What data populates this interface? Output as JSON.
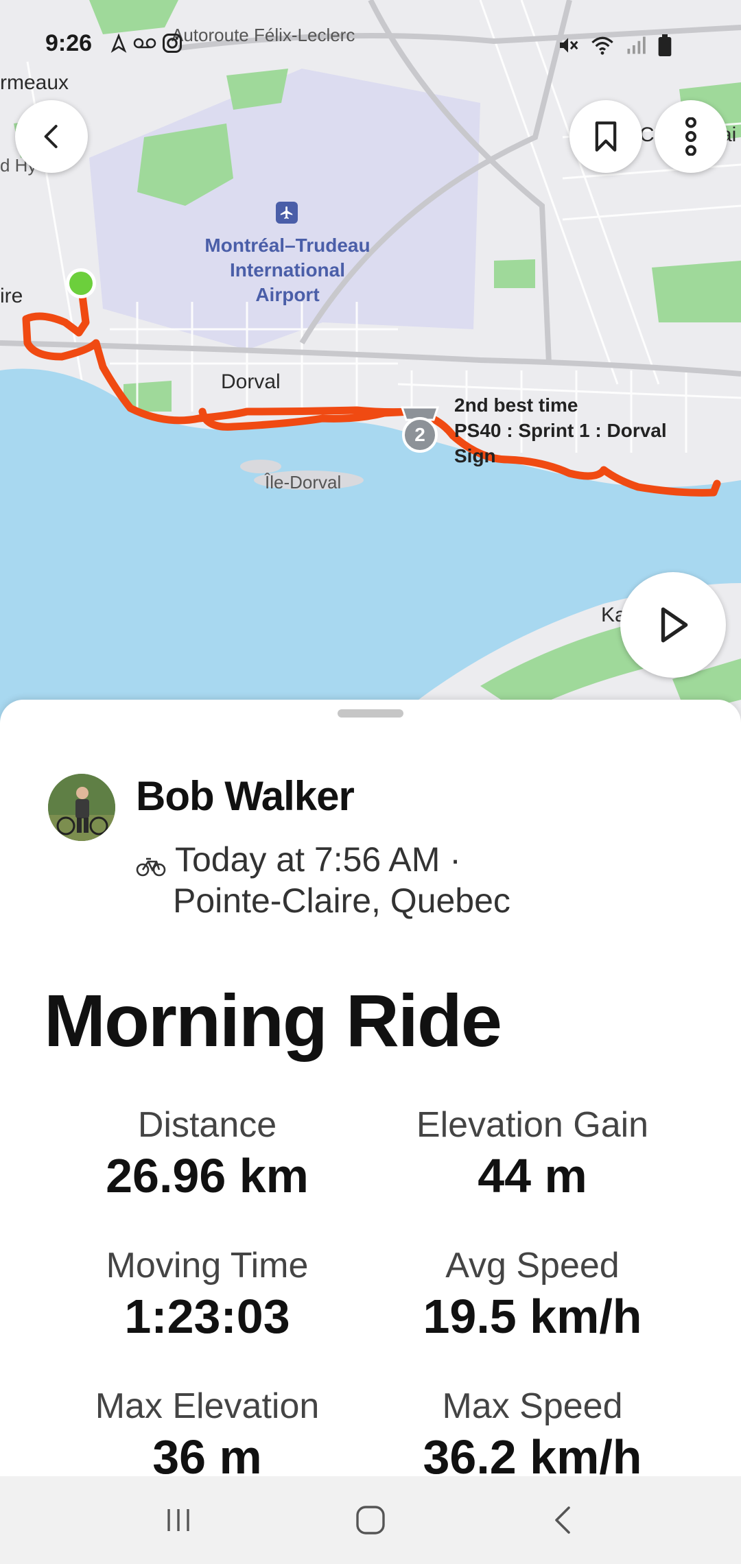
{
  "status_bar": {
    "time": "9:26",
    "icons_left": [
      "navigation-icon",
      "voicemail-icon",
      "instagram-icon"
    ],
    "icons_right": [
      "mute-icon",
      "wifi-icon",
      "signal-icon",
      "battery-icon"
    ]
  },
  "map": {
    "labels": {
      "highway": "Autoroute Félix-Leclerc",
      "ormeaux": "rmeaux",
      "hwy_left": "d Hy",
      "claire": "ire",
      "airport_line1": "Montréal–Trudeau",
      "airport_line2": "International",
      "airport_line3": "Airport",
      "dorval": "Dorval",
      "ile_dorval": "Île-Dorval",
      "c_label": "C",
      "ai_label": "ai",
      "ka_label": "Ka"
    },
    "achievement": {
      "rank": "2",
      "line1": "2nd best time",
      "line2": "PS40 : Sprint 1 : Dorval",
      "line3": "Sign"
    },
    "colors": {
      "water": "#a8d8f0",
      "land": "#ececef",
      "park": "#9fd99a",
      "airport": "#dcdcf0",
      "route": "#f04a12",
      "start_dot": "#6ccf3c"
    }
  },
  "buttons": {
    "back": "back-icon",
    "save": "bookmark-icon",
    "more": "more-vertical-icon",
    "play": "play-icon"
  },
  "activity": {
    "athlete": "Bob Walker",
    "sport_icon": "bike-icon",
    "datetime": "Today at 7:56 AM ·",
    "location": "Pointe-Claire, Quebec",
    "title": "Morning Ride",
    "stats": [
      {
        "label": "Distance",
        "value": "26.96 km"
      },
      {
        "label": "Elevation Gain",
        "value": "44 m"
      },
      {
        "label": "Moving Time",
        "value": "1:23:03"
      },
      {
        "label": "Avg Speed",
        "value": "19.5 km/h"
      },
      {
        "label": "Max Elevation",
        "value": "36 m"
      },
      {
        "label": "Max Speed",
        "value": "36.2 km/h"
      }
    ]
  },
  "nav": {
    "recents": "recent-apps-icon",
    "home": "home-icon",
    "back": "nav-back-icon"
  }
}
